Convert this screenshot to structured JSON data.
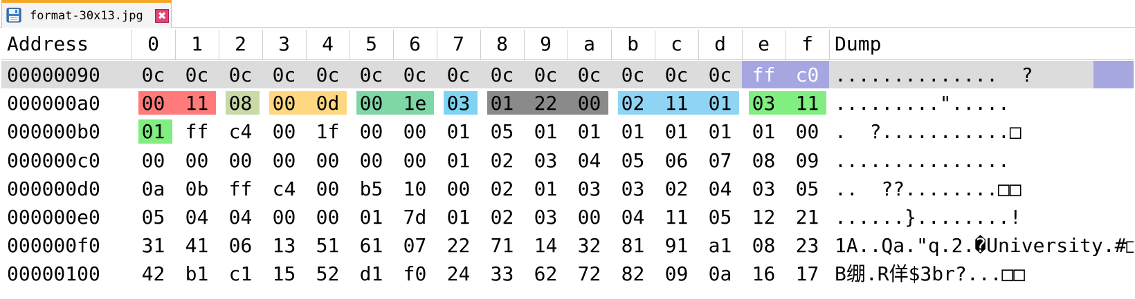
{
  "tab": {
    "filename": "format-30x13.jpg",
    "icon": "floppy-disk-icon",
    "close_glyph": "✖",
    "accent_color": "#f5a623"
  },
  "header": {
    "address": "Address",
    "columns": [
      "0",
      "1",
      "2",
      "3",
      "4",
      "5",
      "6",
      "7",
      "8",
      "9",
      "a",
      "b",
      "c",
      "d",
      "e",
      "f"
    ],
    "dump": "Dump"
  },
  "rows": [
    {
      "address": "00000090",
      "bytes": [
        "0c",
        "0c",
        "0c",
        "0c",
        "0c",
        "0c",
        "0c",
        "0c",
        "0c",
        "0c",
        "0c",
        "0c",
        "0c",
        "0c",
        "ff",
        "c0"
      ],
      "dump": "..............  ?",
      "selected": true
    },
    {
      "address": "000000a0",
      "bytes": [
        "00",
        "11",
        "08",
        "00",
        "0d",
        "00",
        "1e",
        "03",
        "01",
        "22",
        "00",
        "02",
        "11",
        "01",
        "03",
        "11"
      ],
      "dump": ".........\".....",
      "selected": false
    },
    {
      "address": "000000b0",
      "bytes": [
        "01",
        "ff",
        "c4",
        "00",
        "1f",
        "00",
        "00",
        "01",
        "05",
        "01",
        "01",
        "01",
        "01",
        "01",
        "01",
        "00"
      ],
      "dump": ".  ?...........□",
      "selected": false
    },
    {
      "address": "000000c0",
      "bytes": [
        "00",
        "00",
        "00",
        "00",
        "00",
        "00",
        "00",
        "01",
        "02",
        "03",
        "04",
        "05",
        "06",
        "07",
        "08",
        "09"
      ],
      "dump": "...............",
      "selected": false
    },
    {
      "address": "000000d0",
      "bytes": [
        "0a",
        "0b",
        "ff",
        "c4",
        "00",
        "b5",
        "10",
        "00",
        "02",
        "01",
        "03",
        "03",
        "02",
        "04",
        "03",
        "05"
      ],
      "dump": "..  ??........□□",
      "selected": false
    },
    {
      "address": "000000e0",
      "bytes": [
        "05",
        "04",
        "04",
        "00",
        "00",
        "01",
        "7d",
        "01",
        "02",
        "03",
        "00",
        "04",
        "11",
        "05",
        "12",
        "21"
      ],
      "dump": "......}........!",
      "selected": false
    },
    {
      "address": "000000f0",
      "bytes": [
        "31",
        "41",
        "06",
        "13",
        "51",
        "61",
        "07",
        "22",
        "71",
        "14",
        "32",
        "81",
        "91",
        "a1",
        "08",
        "23"
      ],
      "dump": "1A..Qa.\"q.2.�University.#□",
      "selected": false
    },
    {
      "address": "00000100",
      "bytes": [
        "42",
        "b1",
        "c1",
        "15",
        "52",
        "d1",
        "f0",
        "24",
        "33",
        "62",
        "72",
        "82",
        "09",
        "0a",
        "16",
        "17"
      ],
      "dump": "B绷.R佯$3br?...□□",
      "selected": false
    }
  ],
  "highlights": {
    "selected_row_bg": "#dcdcdc",
    "selected_tail_color": "#a6a6e0",
    "groups": [
      {
        "row": 1,
        "from": 0,
        "to": 1,
        "color": "#ff7b7b"
      },
      {
        "row": 1,
        "from": 2,
        "to": 2,
        "color": "#c9d9a8"
      },
      {
        "row": 1,
        "from": 3,
        "to": 4,
        "color": "#ffd780"
      },
      {
        "row": 1,
        "from": 5,
        "to": 6,
        "color": "#7fd6a6"
      },
      {
        "row": 1,
        "from": 7,
        "to": 7,
        "color": "#7fd4f4"
      },
      {
        "row": 1,
        "from": 8,
        "to": 10,
        "color": "#8a8a8a"
      },
      {
        "row": 1,
        "from": 11,
        "to": 13,
        "color": "#8fd4f4"
      },
      {
        "row": 1,
        "from": 14,
        "to": 15,
        "color": "#80ee80"
      },
      {
        "row": 2,
        "from": 0,
        "to": 0,
        "color": "#80ee80"
      }
    ]
  }
}
